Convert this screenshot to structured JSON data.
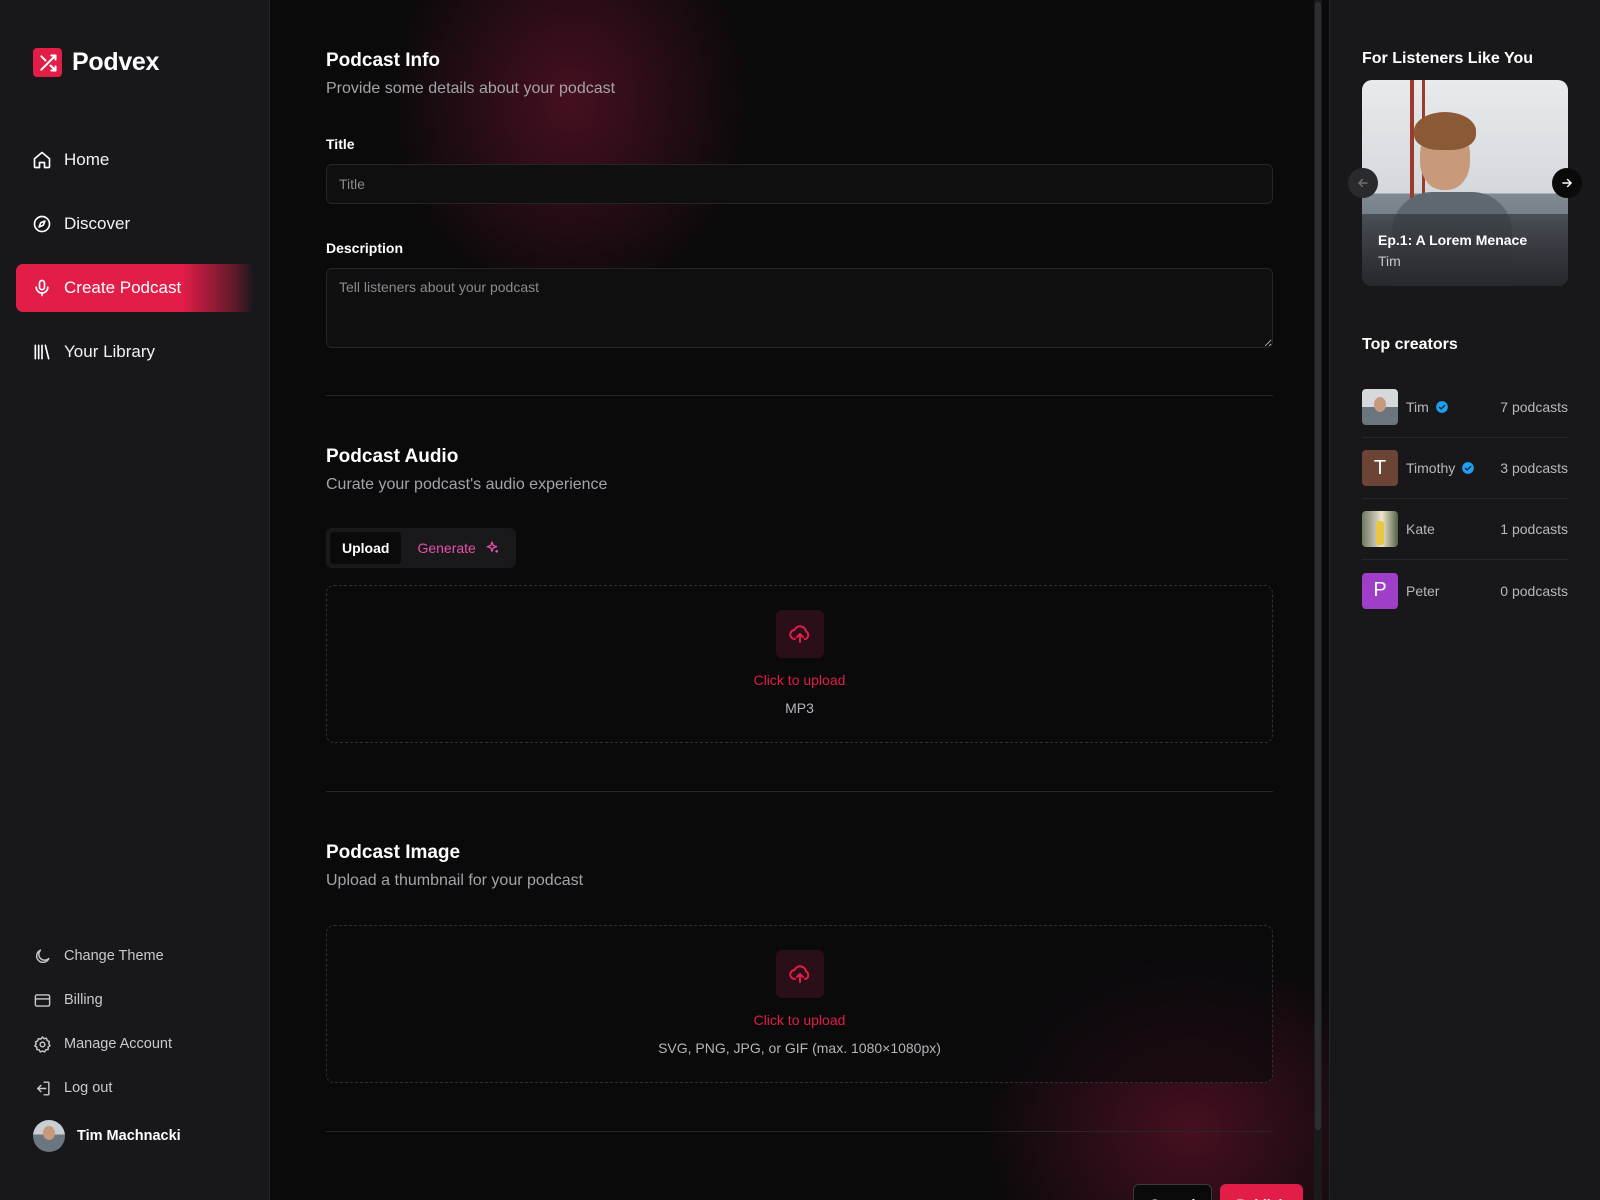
{
  "brand": {
    "name": "Podvex",
    "accent": "#e11d48"
  },
  "nav": {
    "items": [
      {
        "label": "Home",
        "icon": "home-icon"
      },
      {
        "label": "Discover",
        "icon": "compass-icon"
      },
      {
        "label": "Create Podcast",
        "icon": "microphone-icon",
        "active": true
      },
      {
        "label": "Your Library",
        "icon": "library-icon"
      }
    ]
  },
  "bottom_nav": {
    "items": [
      {
        "label": "Change Theme",
        "icon": "moon-icon"
      },
      {
        "label": "Billing",
        "icon": "credit-card-icon"
      },
      {
        "label": "Manage Account",
        "icon": "gear-icon"
      },
      {
        "label": "Log out",
        "icon": "logout-icon"
      }
    ],
    "user_name": "Tim Machnacki"
  },
  "podcast_info": {
    "title": "Podcast Info",
    "subtitle": "Provide some details about your podcast",
    "title_label": "Title",
    "title_placeholder": "Title",
    "description_label": "Description",
    "description_placeholder": "Tell listeners about your podcast"
  },
  "podcast_audio": {
    "title": "Podcast Audio",
    "subtitle": "Curate your podcast's audio experience",
    "tab_upload": "Upload",
    "tab_generate": "Generate",
    "upload_cta": "Click to upload",
    "upload_hint": "MP3"
  },
  "podcast_image": {
    "title": "Podcast Image",
    "subtitle": "Upload a thumbnail for your podcast",
    "upload_cta": "Click to upload",
    "upload_hint": "SVG, PNG, JPG, or GIF (max. 1080×1080px)"
  },
  "actions": {
    "cancel": "Cancel",
    "publish": "Publish"
  },
  "right": {
    "for_listeners_title": "For Listeners Like You",
    "featured": {
      "episode": "Ep.1: A Lorem Menace",
      "author": "Tim"
    },
    "top_creators_title": "Top creators",
    "creators": [
      {
        "name": "Tim",
        "verified": true,
        "count": "7 podcasts",
        "avatar": "photo"
      },
      {
        "name": "Timothy",
        "verified": true,
        "count": "3 podcasts",
        "avatar_letter": "T",
        "avatar_color": "#6b4435"
      },
      {
        "name": "Kate",
        "verified": false,
        "count": "1 podcasts",
        "avatar": "photo"
      },
      {
        "name": "Peter",
        "verified": false,
        "count": "0 podcasts",
        "avatar_letter": "P",
        "avatar_color": "#9f3fc7"
      }
    ]
  }
}
